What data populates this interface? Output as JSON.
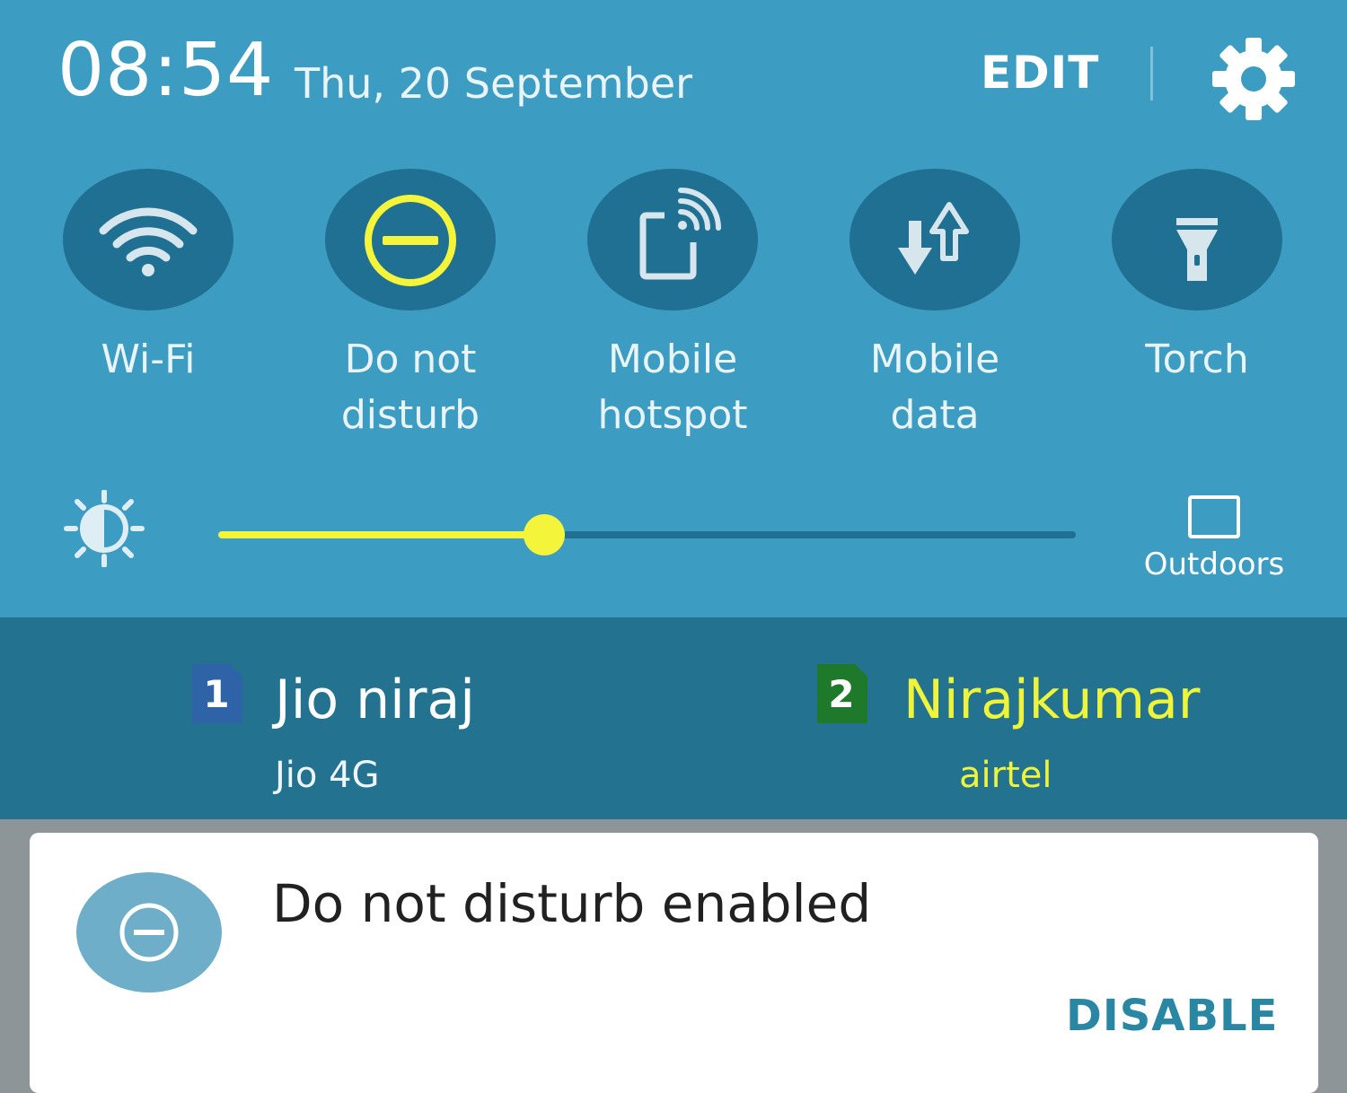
{
  "header": {
    "time": "08:54",
    "date": "Thu, 20 September",
    "edit_label": "EDIT",
    "settings_icon": "gear-icon"
  },
  "quick_settings": [
    {
      "id": "wifi",
      "label_lines": [
        "Wi-Fi"
      ],
      "icon": "wifi-icon",
      "active": false
    },
    {
      "id": "dnd",
      "label_lines": [
        "Do not",
        "disturb"
      ],
      "icon": "do-not-disturb-icon",
      "active": true
    },
    {
      "id": "hotspot",
      "label_lines": [
        "Mobile",
        "hotspot"
      ],
      "icon": "mobile-hotspot-icon",
      "active": false
    },
    {
      "id": "data",
      "label_lines": [
        "Mobile",
        "data"
      ],
      "icon": "mobile-data-icon",
      "active": false
    },
    {
      "id": "torch",
      "label_lines": [
        "Torch"
      ],
      "icon": "torch-icon",
      "active": false
    }
  ],
  "brightness": {
    "icon": "brightness-icon",
    "level": 0.38,
    "outdoors_label": "Outdoors"
  },
  "sims": [
    {
      "slot": "1",
      "name": "Jio niraj",
      "carrier": "Jio 4G",
      "badge_color": "#2f63a8",
      "text_color": "#ffffff",
      "carrier_color": "#eef6f9"
    },
    {
      "slot": "2",
      "name": "Nirajkumar",
      "carrier": "airtel",
      "badge_color": "#1e7a2a",
      "text_color": "#eef43a",
      "carrier_color": "#eef43a"
    }
  ],
  "notification": {
    "icon": "do-not-disturb-icon",
    "title": "Do not disturb enabled",
    "action_label": "DISABLE"
  },
  "colors": {
    "panel": "#3d9cc2",
    "tile": "#1f7093",
    "accent": "#f4f43a",
    "sim_bar": "#23728f"
  }
}
